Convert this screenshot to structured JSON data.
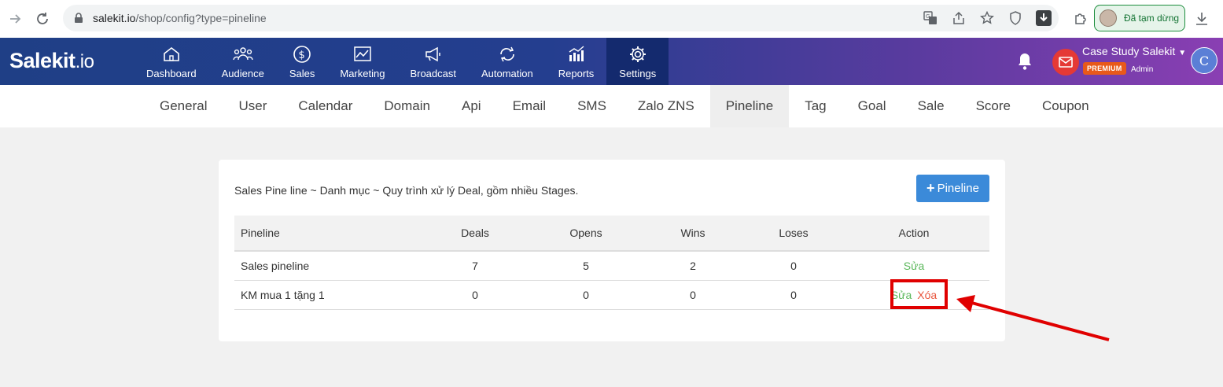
{
  "browser": {
    "url_host": "salekit.io",
    "url_path": "/shop/config?type=pineline",
    "profile_status": "Đã tạm dừng"
  },
  "app": {
    "logo_main": "Salekit",
    "logo_suffix": ".io",
    "nav": [
      {
        "label": "Dashboard",
        "icon": "home-icon"
      },
      {
        "label": "Audience",
        "icon": "users-icon"
      },
      {
        "label": "Sales",
        "icon": "dollar-icon"
      },
      {
        "label": "Marketing",
        "icon": "chart-line-icon"
      },
      {
        "label": "Broadcast",
        "icon": "megaphone-icon"
      },
      {
        "label": "Automation",
        "icon": "repeat-icon"
      },
      {
        "label": "Reports",
        "icon": "bar-chart-icon"
      },
      {
        "label": "Settings",
        "icon": "gear-icon"
      }
    ],
    "active_nav": "Settings",
    "account": {
      "name": "Case Study Salekit",
      "badge": "PREMIUM",
      "role": "Admin",
      "avatar_letter": "C"
    }
  },
  "settings_tabs": [
    "General",
    "User",
    "Calendar",
    "Domain",
    "Api",
    "Email",
    "SMS",
    "Zalo ZNS",
    "Pineline",
    "Tag",
    "Goal",
    "Sale",
    "Score",
    "Coupon"
  ],
  "active_tab": "Pineline",
  "content": {
    "description": "Sales Pine line ~ Danh mục ~ Quy trình xử lý Deal, gồm nhiều Stages.",
    "add_button_label": "Pineline",
    "table": {
      "headers": [
        "Pineline",
        "Deals",
        "Opens",
        "Wins",
        "Loses",
        "Action"
      ],
      "rows": [
        {
          "name": "Sales pineline",
          "deals": "7",
          "opens": "5",
          "wins": "2",
          "loses": "0",
          "edit": "Sửa",
          "delete": ""
        },
        {
          "name": "KM mua 1 tặng 1",
          "deals": "0",
          "opens": "0",
          "wins": "0",
          "loses": "0",
          "edit": "Sửa",
          "delete": "Xóa"
        }
      ]
    }
  },
  "colors": {
    "edit_link": "#5cb85c",
    "delete_link": "#e9573f",
    "primary_button": "#3b8ad9",
    "annotation": "#e00000"
  }
}
